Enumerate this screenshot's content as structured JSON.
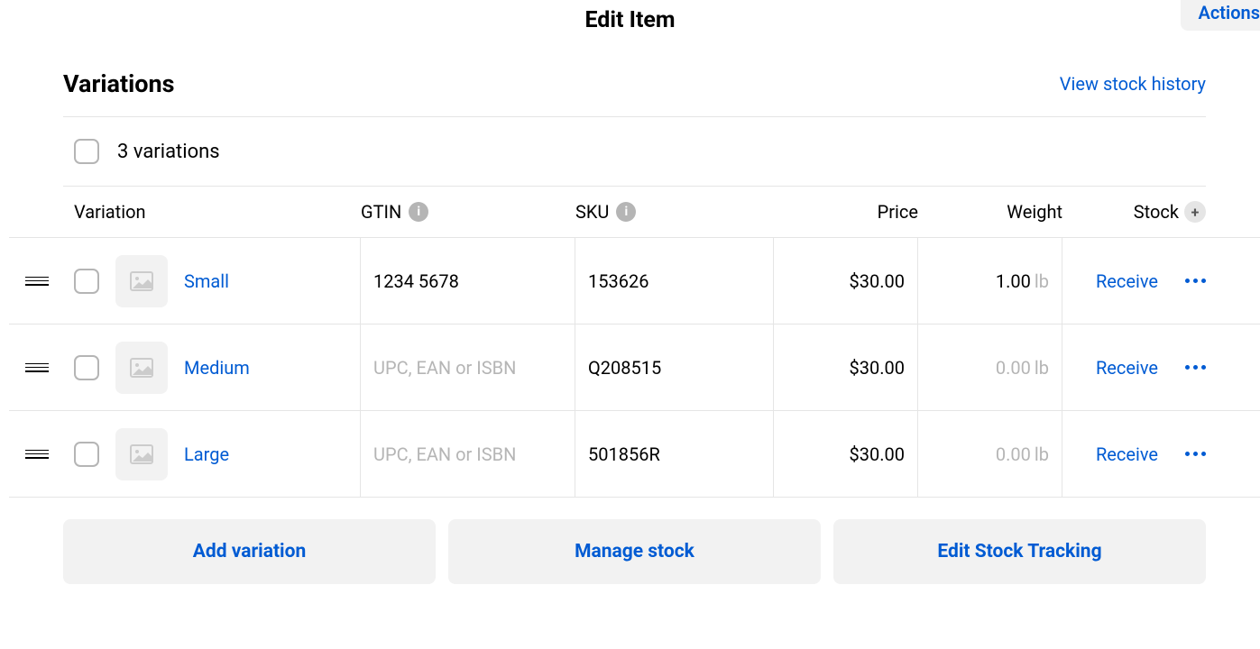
{
  "header": {
    "title": "Edit Item",
    "actions_label": "Actions"
  },
  "section": {
    "title": "Variations",
    "history_link": "View stock history",
    "count_label": "3 variations"
  },
  "columns": {
    "variation": "Variation",
    "gtin": "GTIN",
    "sku": "SKU",
    "price": "Price",
    "weight": "Weight",
    "stock": "Stock"
  },
  "gtin_placeholder": "UPC, EAN or ISBN",
  "weight_unit": "lb",
  "receive_label": "Receive",
  "rows": [
    {
      "name": "Small",
      "gtin": "1234 5678",
      "sku": "153626",
      "price": "$30.00",
      "weight": "1.00",
      "weight_zero": false
    },
    {
      "name": "Medium",
      "gtin": "",
      "sku": "Q208515",
      "price": "$30.00",
      "weight": "0.00",
      "weight_zero": true
    },
    {
      "name": "Large",
      "gtin": "",
      "sku": "501856R",
      "price": "$30.00",
      "weight": "0.00",
      "weight_zero": true
    }
  ],
  "footer": {
    "add": "Add variation",
    "manage": "Manage stock",
    "edit_tracking": "Edit Stock Tracking"
  }
}
